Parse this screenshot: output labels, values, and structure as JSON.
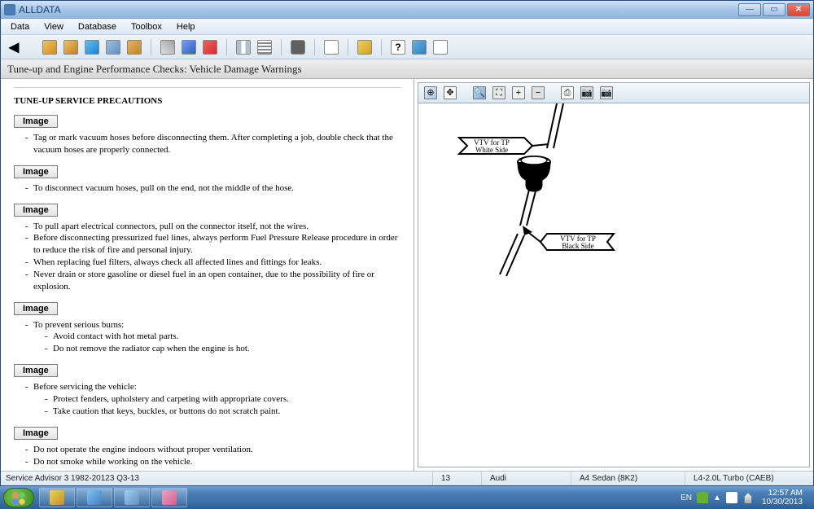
{
  "title": "ALLDATA",
  "menu": [
    "Data",
    "View",
    "Database",
    "Toolbox",
    "Help"
  ],
  "header": "Tune-up and Engine Performance Checks:  Vehicle Damage Warnings",
  "img_button_label": "Image",
  "doc": {
    "title": "TUNE-UP SERVICE PRECAUTIONS",
    "s1": "Tag or mark vacuum hoses before disconnecting them. After completing a job, double check that the vacuum hoses are properly connected.",
    "s2": "To disconnect vacuum hoses, pull on the end, not the middle of the hose.",
    "s3a": "To pull apart electrical connectors, pull on the connector itself, not the wires.",
    "s3b": "Before disconnecting pressurized fuel lines, always perform Fuel Pressure Release procedure in order to reduce the risk of fire and personal injury.",
    "s3c": "When replacing fuel filters, always check all affected lines and fittings for leaks.",
    "s3d": "Never drain or store gasoline or diesel fuel in an open container, due to the possibility of fire or explosion.",
    "s4": "To prevent serious burns:",
    "s4a": "Avoid contact with hot metal parts.",
    "s4b": "Do not remove the radiator cap when the engine is hot.",
    "s5": "Before servicing the vehicle:",
    "s5a": "Protect fenders, upholstery and carpeting with appropriate covers.",
    "s5b": "Take caution that keys, buckles, or buttons do not scratch paint.",
    "s6a": "Do not operate the engine indoors without proper ventilation.",
    "s6b": "Do not smoke while working on the vehicle."
  },
  "diagram": {
    "label_top_1": "VTV for TP",
    "label_top_2": "White Side",
    "label_bot_1": "VTV for TP",
    "label_bot_2": "Black Side"
  },
  "status": {
    "advisor": "Service Advisor 3 1982-20123 Q3-13",
    "page": "13",
    "make": "Audi",
    "model": "A4 Sedan (8K2)",
    "engine": "L4-2.0L Turbo (CAEB)"
  },
  "tray": {
    "lang": "EN",
    "time": "12:57 AM",
    "date": "10/30/2013"
  }
}
